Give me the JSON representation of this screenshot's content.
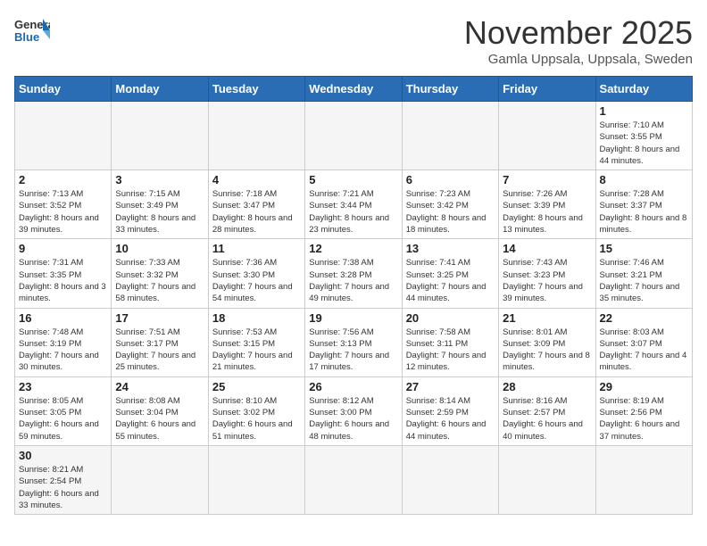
{
  "header": {
    "logo_line1": "General",
    "logo_line2": "Blue",
    "month_title": "November 2025",
    "subtitle": "Gamla Uppsala, Uppsala, Sweden"
  },
  "weekdays": [
    "Sunday",
    "Monday",
    "Tuesday",
    "Wednesday",
    "Thursday",
    "Friday",
    "Saturday"
  ],
  "weeks": [
    [
      {
        "day": "",
        "info": ""
      },
      {
        "day": "",
        "info": ""
      },
      {
        "day": "",
        "info": ""
      },
      {
        "day": "",
        "info": ""
      },
      {
        "day": "",
        "info": ""
      },
      {
        "day": "",
        "info": ""
      },
      {
        "day": "1",
        "info": "Sunrise: 7:10 AM\nSunset: 3:55 PM\nDaylight: 8 hours\nand 44 minutes."
      }
    ],
    [
      {
        "day": "2",
        "info": "Sunrise: 7:13 AM\nSunset: 3:52 PM\nDaylight: 8 hours\nand 39 minutes."
      },
      {
        "day": "3",
        "info": "Sunrise: 7:15 AM\nSunset: 3:49 PM\nDaylight: 8 hours\nand 33 minutes."
      },
      {
        "day": "4",
        "info": "Sunrise: 7:18 AM\nSunset: 3:47 PM\nDaylight: 8 hours\nand 28 minutes."
      },
      {
        "day": "5",
        "info": "Sunrise: 7:21 AM\nSunset: 3:44 PM\nDaylight: 8 hours\nand 23 minutes."
      },
      {
        "day": "6",
        "info": "Sunrise: 7:23 AM\nSunset: 3:42 PM\nDaylight: 8 hours\nand 18 minutes."
      },
      {
        "day": "7",
        "info": "Sunrise: 7:26 AM\nSunset: 3:39 PM\nDaylight: 8 hours\nand 13 minutes."
      },
      {
        "day": "8",
        "info": "Sunrise: 7:28 AM\nSunset: 3:37 PM\nDaylight: 8 hours\nand 8 minutes."
      }
    ],
    [
      {
        "day": "9",
        "info": "Sunrise: 7:31 AM\nSunset: 3:35 PM\nDaylight: 8 hours\nand 3 minutes."
      },
      {
        "day": "10",
        "info": "Sunrise: 7:33 AM\nSunset: 3:32 PM\nDaylight: 7 hours\nand 58 minutes."
      },
      {
        "day": "11",
        "info": "Sunrise: 7:36 AM\nSunset: 3:30 PM\nDaylight: 7 hours\nand 54 minutes."
      },
      {
        "day": "12",
        "info": "Sunrise: 7:38 AM\nSunset: 3:28 PM\nDaylight: 7 hours\nand 49 minutes."
      },
      {
        "day": "13",
        "info": "Sunrise: 7:41 AM\nSunset: 3:25 PM\nDaylight: 7 hours\nand 44 minutes."
      },
      {
        "day": "14",
        "info": "Sunrise: 7:43 AM\nSunset: 3:23 PM\nDaylight: 7 hours\nand 39 minutes."
      },
      {
        "day": "15",
        "info": "Sunrise: 7:46 AM\nSunset: 3:21 PM\nDaylight: 7 hours\nand 35 minutes."
      }
    ],
    [
      {
        "day": "16",
        "info": "Sunrise: 7:48 AM\nSunset: 3:19 PM\nDaylight: 7 hours\nand 30 minutes."
      },
      {
        "day": "17",
        "info": "Sunrise: 7:51 AM\nSunset: 3:17 PM\nDaylight: 7 hours\nand 25 minutes."
      },
      {
        "day": "18",
        "info": "Sunrise: 7:53 AM\nSunset: 3:15 PM\nDaylight: 7 hours\nand 21 minutes."
      },
      {
        "day": "19",
        "info": "Sunrise: 7:56 AM\nSunset: 3:13 PM\nDaylight: 7 hours\nand 17 minutes."
      },
      {
        "day": "20",
        "info": "Sunrise: 7:58 AM\nSunset: 3:11 PM\nDaylight: 7 hours\nand 12 minutes."
      },
      {
        "day": "21",
        "info": "Sunrise: 8:01 AM\nSunset: 3:09 PM\nDaylight: 7 hours\nand 8 minutes."
      },
      {
        "day": "22",
        "info": "Sunrise: 8:03 AM\nSunset: 3:07 PM\nDaylight: 7 hours\nand 4 minutes."
      }
    ],
    [
      {
        "day": "23",
        "info": "Sunrise: 8:05 AM\nSunset: 3:05 PM\nDaylight: 6 hours\nand 59 minutes."
      },
      {
        "day": "24",
        "info": "Sunrise: 8:08 AM\nSunset: 3:04 PM\nDaylight: 6 hours\nand 55 minutes."
      },
      {
        "day": "25",
        "info": "Sunrise: 8:10 AM\nSunset: 3:02 PM\nDaylight: 6 hours\nand 51 minutes."
      },
      {
        "day": "26",
        "info": "Sunrise: 8:12 AM\nSunset: 3:00 PM\nDaylight: 6 hours\nand 48 minutes."
      },
      {
        "day": "27",
        "info": "Sunrise: 8:14 AM\nSunset: 2:59 PM\nDaylight: 6 hours\nand 44 minutes."
      },
      {
        "day": "28",
        "info": "Sunrise: 8:16 AM\nSunset: 2:57 PM\nDaylight: 6 hours\nand 40 minutes."
      },
      {
        "day": "29",
        "info": "Sunrise: 8:19 AM\nSunset: 2:56 PM\nDaylight: 6 hours\nand 37 minutes."
      }
    ],
    [
      {
        "day": "30",
        "info": "Sunrise: 8:21 AM\nSunset: 2:54 PM\nDaylight: 6 hours\nand 33 minutes."
      },
      {
        "day": "",
        "info": ""
      },
      {
        "day": "",
        "info": ""
      },
      {
        "day": "",
        "info": ""
      },
      {
        "day": "",
        "info": ""
      },
      {
        "day": "",
        "info": ""
      },
      {
        "day": "",
        "info": ""
      }
    ]
  ]
}
